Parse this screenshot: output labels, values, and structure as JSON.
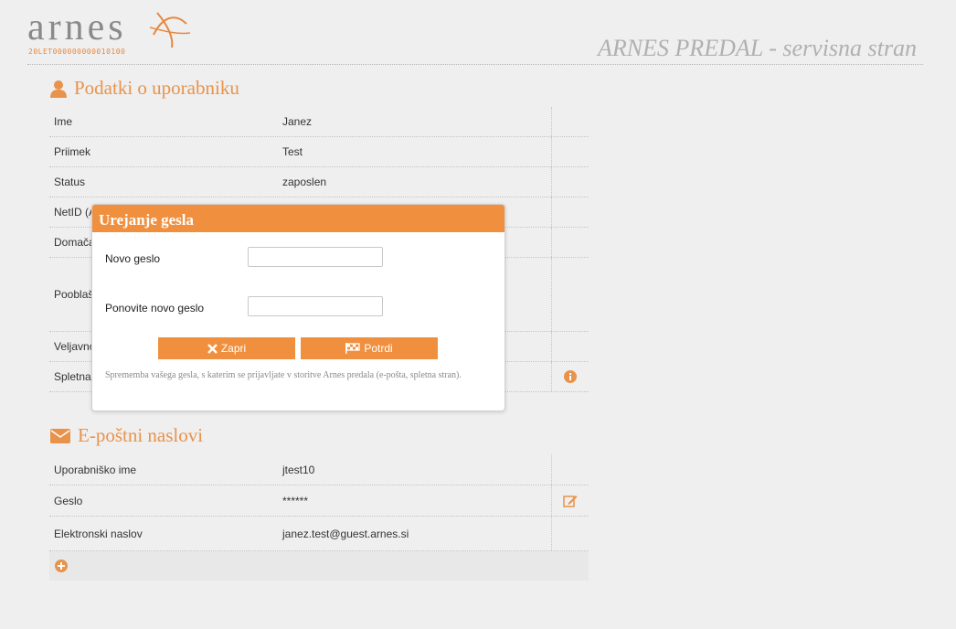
{
  "header": {
    "logo_text": "arnes",
    "logo_sub": "20LET000000000010100",
    "site_title": "ARNES PREDAL - servisna stran"
  },
  "user_section": {
    "title": "Podatki o uporabniku",
    "icon": "user-icon",
    "rows": [
      {
        "label": "Ime",
        "value": "Janez"
      },
      {
        "label": "Priimek",
        "value": "Test"
      },
      {
        "label": "Status",
        "value": "zaposlen"
      },
      {
        "label": "NetID (A",
        "value": ""
      },
      {
        "label": "Domača",
        "value": ""
      },
      {
        "label": "Pooblaš",
        "value": ""
      },
      {
        "label": "Veljavno",
        "value": ""
      },
      {
        "label": "Spletna",
        "value": "",
        "action_icon": "info-icon"
      }
    ]
  },
  "email_section": {
    "title": "E-poštni naslovi",
    "icon": "envelope-icon",
    "rows": [
      {
        "label": "Uporabniško ime",
        "value": "jtest10"
      },
      {
        "label": "Geslo",
        "value": "******",
        "action_icon": "edit-icon"
      },
      {
        "label": "Elektronski naslov",
        "value": "janez.test@guest.arnes.si"
      }
    ],
    "add_icon": "plus-circle-icon"
  },
  "modal": {
    "title": "Urejanje gesla",
    "new_password_label": "Novo geslo",
    "new_password_value": "",
    "repeat_password_label": "Ponovite novo geslo",
    "repeat_password_value": "",
    "close_label": "Zapri",
    "confirm_label": "Potrdi",
    "note": "Sprememba vašega gesla, s katerim se prijavljate v storitve Arnes predala (e-pošta, spletna stran)."
  },
  "colors": {
    "accent": "#f0903f",
    "section_title": "#e8934c",
    "background": "#efefef"
  }
}
